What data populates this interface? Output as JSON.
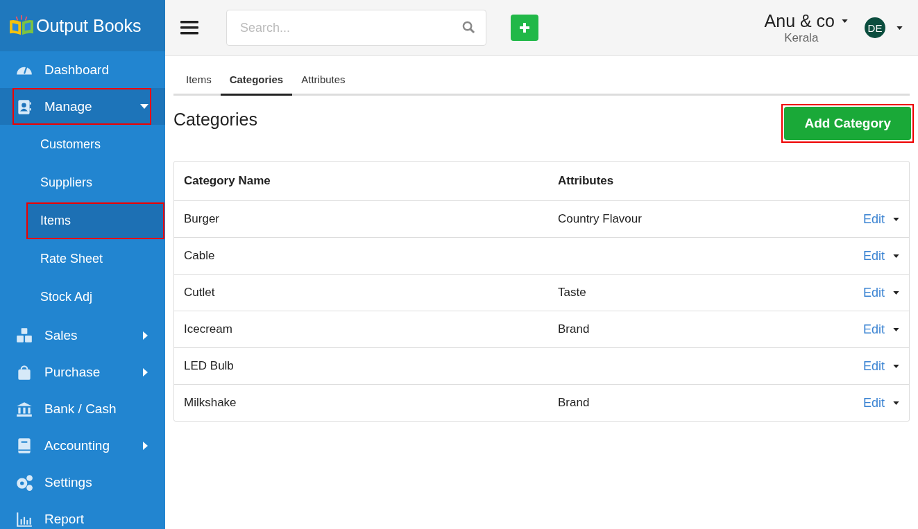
{
  "brand": {
    "name": "Output Books"
  },
  "sidebar": {
    "items": [
      {
        "label": "Dashboard",
        "kind": "link",
        "selected": false,
        "highlighted": false
      },
      {
        "label": "Manage",
        "kind": "group",
        "expanded": true,
        "selected": true,
        "highlighted": true,
        "children": [
          {
            "label": "Customers",
            "selected": false,
            "highlighted": false
          },
          {
            "label": "Suppliers",
            "selected": false,
            "highlighted": false
          },
          {
            "label": "Items",
            "selected": true,
            "highlighted": true
          },
          {
            "label": "Rate Sheet",
            "selected": false,
            "highlighted": false
          },
          {
            "label": "Stock Adj",
            "selected": false,
            "highlighted": false
          }
        ]
      },
      {
        "label": "Sales",
        "kind": "group",
        "expanded": false,
        "selected": false,
        "highlighted": false
      },
      {
        "label": "Purchase",
        "kind": "group",
        "expanded": false,
        "selected": false,
        "highlighted": false
      },
      {
        "label": "Bank / Cash",
        "kind": "link",
        "selected": false,
        "highlighted": false
      },
      {
        "label": "Accounting",
        "kind": "group",
        "expanded": false,
        "selected": false,
        "highlighted": false
      },
      {
        "label": "Settings",
        "kind": "link",
        "selected": false,
        "highlighted": false
      },
      {
        "label": "Report",
        "kind": "link",
        "selected": false,
        "highlighted": false
      }
    ]
  },
  "header": {
    "search": {
      "placeholder": "Search..."
    },
    "company": "Anu & co",
    "location": "Kerala",
    "avatar": "DE"
  },
  "tabs": [
    {
      "label": "Items",
      "selected": false
    },
    {
      "label": "Categories",
      "selected": true
    },
    {
      "label": "Attributes",
      "selected": false
    }
  ],
  "page": {
    "title": "Categories",
    "add_button": {
      "label": "Add Category",
      "highlighted": true
    }
  },
  "table": {
    "columns": [
      "Category Name",
      "Attributes"
    ],
    "rows": [
      {
        "name": "Burger",
        "attributes": "Country Flavour",
        "action": "Edit"
      },
      {
        "name": "Cable",
        "action": "Edit"
      },
      {
        "name": "Cutlet",
        "attributes": "Taste",
        "action": "Edit"
      },
      {
        "name": "Icecream",
        "attributes": "Brand",
        "action": "Edit"
      },
      {
        "name": "LED Bulb",
        "action": "Edit"
      },
      {
        "name": "Milkshake",
        "attributes": "Brand",
        "action": "Edit"
      }
    ]
  }
}
